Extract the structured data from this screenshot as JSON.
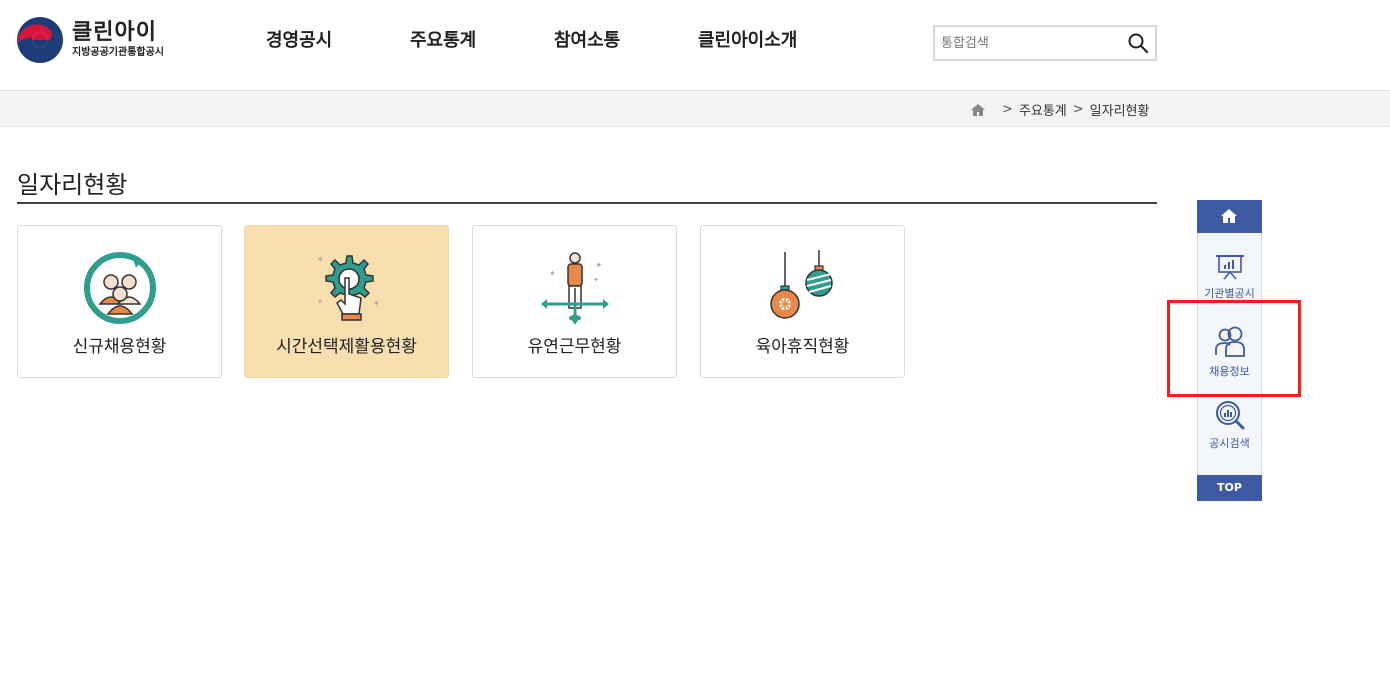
{
  "logo": {
    "title": "클린아이",
    "subtitle": "지방공공기관통합공시"
  },
  "nav": {
    "items": [
      "경영공시",
      "주요통계",
      "참여소통",
      "클린아이소개"
    ]
  },
  "search": {
    "placeholder": "통합검색",
    "value": ""
  },
  "breadcrumb": {
    "items": [
      "주요통계",
      "일자리현황"
    ],
    "separator": ">"
  },
  "page": {
    "title": "일자리현황"
  },
  "cards": [
    {
      "label": "신규채용현황",
      "icon": "new-hire-icon",
      "active": false
    },
    {
      "label": "시간선택제활용현황",
      "icon": "gear-touch-icon",
      "active": true
    },
    {
      "label": "유연근무현황",
      "icon": "flexible-work-icon",
      "active": false
    },
    {
      "label": "육아휴직현황",
      "icon": "ornament-icon",
      "active": false
    }
  ],
  "quick_menu": {
    "items": [
      {
        "label": "기관별공시",
        "icon": "presentation-chart-icon"
      },
      {
        "label": "채용정보",
        "icon": "people-icon"
      },
      {
        "label": "공시검색",
        "icon": "search-chart-icon"
      }
    ],
    "top_label": "TOP"
  },
  "colors": {
    "accent": "#3d5aa3",
    "active_card": "#f7dfb0",
    "highlight": "#ff1a1a",
    "teal": "#2f9e8f",
    "orange": "#e8894a"
  }
}
